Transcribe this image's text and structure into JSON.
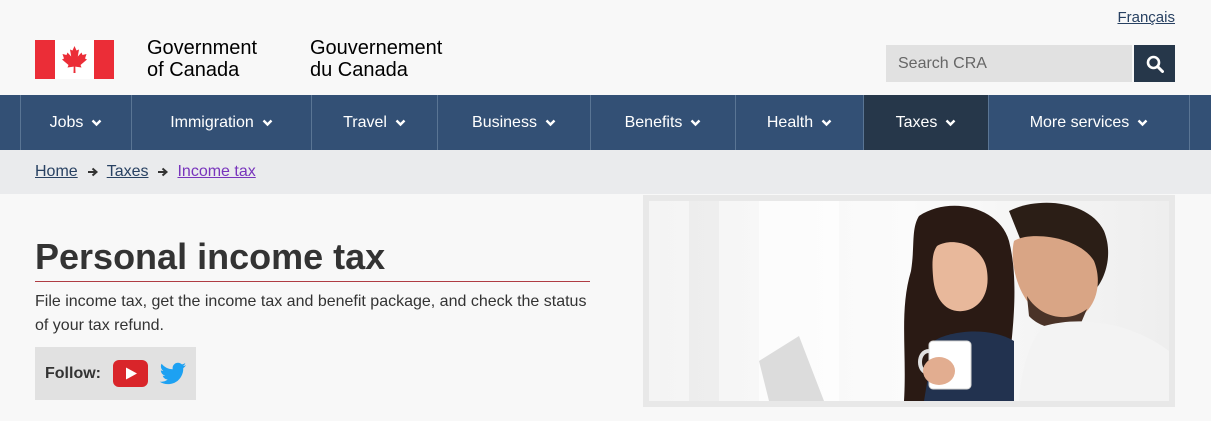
{
  "header": {
    "gov_en_line1": "Government",
    "gov_en_line2": "of Canada",
    "gov_fr_line1": "Gouvernement",
    "gov_fr_line2": "du Canada",
    "language_link": "Français"
  },
  "search": {
    "placeholder": "Search CRA",
    "value": ""
  },
  "nav": {
    "items": [
      {
        "label": "Jobs"
      },
      {
        "label": "Immigration"
      },
      {
        "label": "Travel"
      },
      {
        "label": "Business"
      },
      {
        "label": "Benefits"
      },
      {
        "label": "Health"
      },
      {
        "label": "Taxes"
      },
      {
        "label": "More services"
      }
    ]
  },
  "breadcrumb": {
    "items": [
      "Home",
      "Taxes",
      "Income tax"
    ]
  },
  "main": {
    "title": "Personal income tax",
    "description": "File income tax, get the income tax and benefit package, and check the status of your tax refund.",
    "follow_label": "Follow:"
  },
  "colors": {
    "nav_bg": "#335075",
    "nav_active": "#26374a",
    "flag_red": "#eb2d37",
    "rule_red": "#af3c43",
    "link": "#284162",
    "visited_link": "#7834bc"
  },
  "icons": {
    "flag": "canada-flag-icon",
    "search": "search-icon",
    "chevron": "chevron-down-icon",
    "arrow": "arrow-right-icon",
    "youtube": "youtube-icon",
    "twitter": "twitter-icon"
  }
}
